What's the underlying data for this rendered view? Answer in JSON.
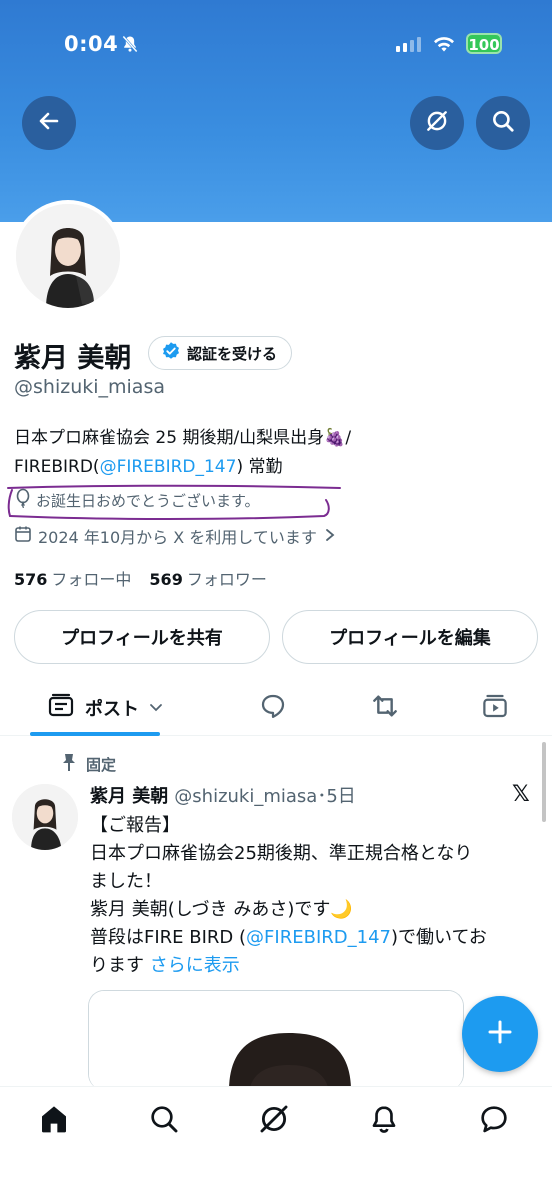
{
  "status_bar": {
    "time": "0:04",
    "battery": "100"
  },
  "header": {
    "back_icon": "arrow-left-icon",
    "grok_icon": "grok-icon",
    "search_icon": "search-icon"
  },
  "profile": {
    "name": "紫月 美朝",
    "verify_label": "認証を受ける",
    "handle": "@shizuki_miasa",
    "bio_line1": "日本プロ麻雀協会 25 期後期/山梨県出身🍇/",
    "bio_line2_prefix": "FIREBIRD(",
    "bio_line2_link": "@FIREBIRD_147",
    "bio_line2_suffix": ") 常勤",
    "birthday": "お誕生日おめでとうございます。",
    "joined": "2024 年10月から X を利用しています",
    "following_count": "576",
    "following_label": "フォロー中",
    "followers_count": "569",
    "followers_label": "フォロワー",
    "share_button": "プロフィールを共有",
    "edit_button": "プロフィールを編集",
    "annotation_color": "#7b2c91"
  },
  "tabs": {
    "posts_label": "ポスト"
  },
  "pinned_post": {
    "pinned_label": "固定",
    "name": "紫月 美朝",
    "handle_time": "@shizuki_miasa･5日",
    "x_logo": "𝕏",
    "line1": "【ご報告】",
    "line2": "日本プロ麻雀協会25期後期、準正規合格となり",
    "line3": "ました！",
    "line4": "紫月 美朝(しづき みあさ)です🌙",
    "line5_prefix": "普段はFIRE BIRD (",
    "line5_link": "@FIREBIRD_147",
    "line5_suffix": ")で働いてお",
    "line6_prefix": "ります ",
    "line6_more": "さらに表示"
  },
  "colors": {
    "accent": "#1d9bf0",
    "banner": "#3a8ee0"
  }
}
